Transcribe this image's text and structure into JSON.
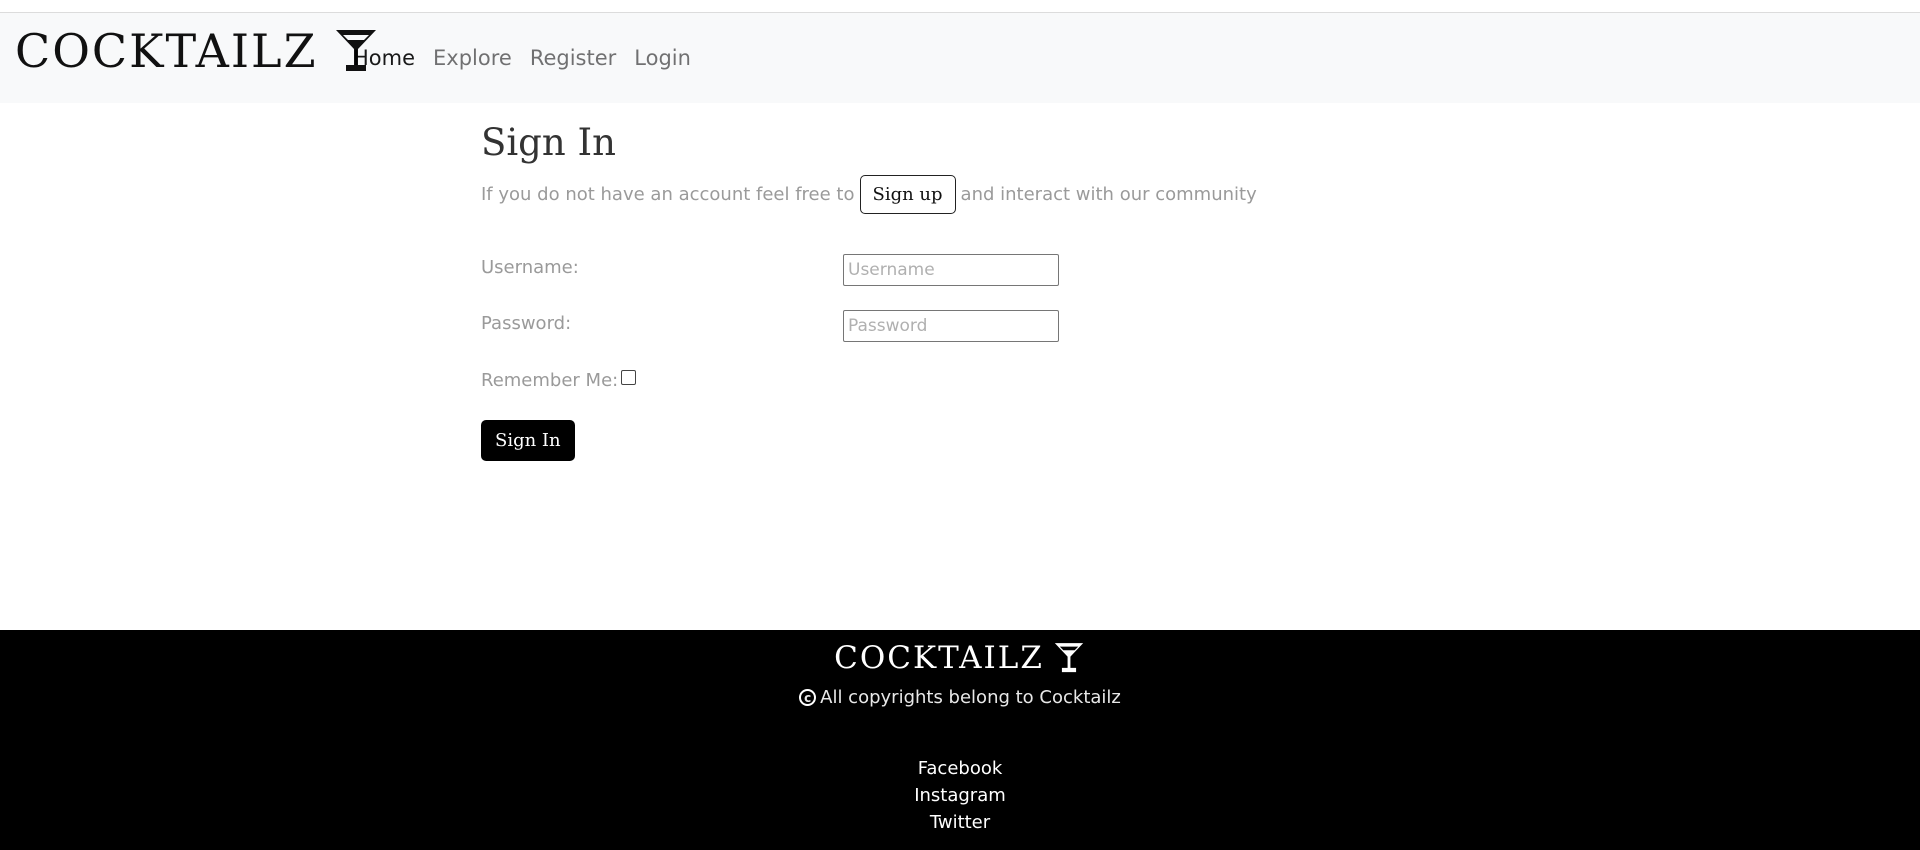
{
  "header": {
    "brand": "COCKTAILZ",
    "brand_icon": "cocktail-glass-icon",
    "nav": [
      {
        "label": "Home",
        "active": true
      },
      {
        "label": "Explore",
        "active": false
      },
      {
        "label": "Register",
        "active": false
      },
      {
        "label": "Login",
        "active": false
      }
    ]
  },
  "main": {
    "title": "Sign In",
    "intro_before": "If you do not have an account feel free to",
    "signup_label": "Sign up",
    "intro_after": "and interact with our community",
    "username_label": "Username:",
    "username_placeholder": "Username",
    "password_label": "Password:",
    "password_placeholder": "Password",
    "remember_label": "Remember Me:",
    "remember_checked": false,
    "submit_label": "Sign In"
  },
  "footer": {
    "brand": "COCKTAILZ",
    "brand_icon": "cocktail-glass-icon",
    "copyright_icon": "copyright-icon",
    "copyright": "All copyrights belong to Cocktailz",
    "social": [
      "Facebook",
      "Instagram",
      "Twitter"
    ]
  },
  "colors": {
    "navbar_bg": "#f8f9fa",
    "footer_bg": "#000000",
    "muted_text": "#9a9a9a",
    "primary_button": "#000000"
  }
}
